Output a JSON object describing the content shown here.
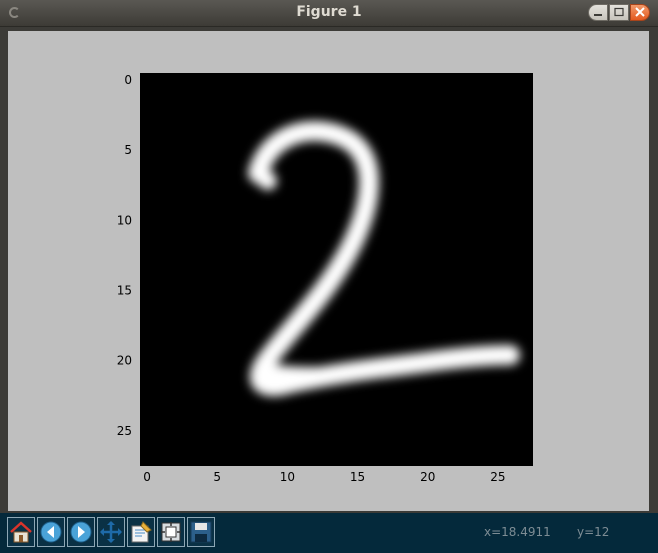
{
  "window": {
    "title": "Figure 1"
  },
  "axes": {
    "y_ticks": [
      "0",
      "5",
      "10",
      "15",
      "20",
      "25"
    ],
    "x_ticks": [
      "0",
      "5",
      "10",
      "15",
      "20",
      "25"
    ]
  },
  "toolbar": {
    "buttons": [
      {
        "icon": "home-icon"
      },
      {
        "icon": "back-icon"
      },
      {
        "icon": "forward-icon"
      },
      {
        "icon": "pan-icon"
      },
      {
        "icon": "zoom-icon"
      },
      {
        "icon": "subplots-icon"
      },
      {
        "icon": "save-icon"
      }
    ],
    "coord_x": "x=18.4911",
    "coord_y": "y=12"
  },
  "colors": {
    "canvas_bg": "#bfbfbf",
    "toolbar_bg": "#04293b",
    "image_bg": "#000000",
    "stroke": "#ffffff"
  }
}
